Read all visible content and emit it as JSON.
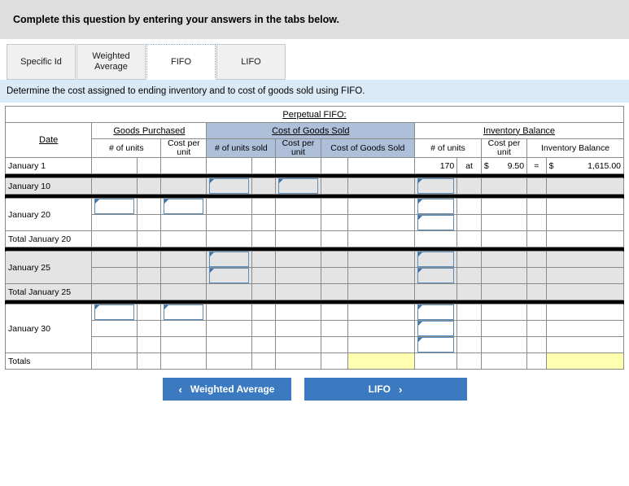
{
  "instruction": {
    "text": "Complete this question by entering your answers in the tabs below."
  },
  "tabs": [
    {
      "label": "Specific Id",
      "active": false
    },
    {
      "label": "Weighted Average",
      "active": false
    },
    {
      "label": "FIFO",
      "active": true
    },
    {
      "label": "LIFO",
      "active": false
    }
  ],
  "sub_instruction": {
    "text": "Determine the cost assigned to ending inventory and to cost of goods sold using FIFO."
  },
  "table": {
    "title": "Perpetual FIFO:",
    "groups": {
      "date": "Date",
      "goods_purchased": "Goods Purchased",
      "cost_of_goods_sold": "Cost of Goods Sold",
      "inventory_balance": "Inventory Balance"
    },
    "columns": {
      "gp_units": "# of units",
      "gp_cost_per_unit": "Cost per unit",
      "cogs_units_sold": "# of units sold",
      "cogs_cost_per_unit": "Cost per unit",
      "cogs_total": "Cost of Goods Sold",
      "inv_units": "# of units",
      "inv_cost_per_unit": "Cost per unit",
      "inv_balance": "Inventory Balance"
    },
    "rows": {
      "january_1": {
        "date": "January 1",
        "inv_units": "170",
        "at": "at",
        "inv_cost_dollar": "$",
        "inv_cost_per_unit": "9.50",
        "equals": "=",
        "inv_balance_dollar": "$",
        "inv_balance": "1,615.00"
      },
      "january_10": {
        "date": "January 10"
      },
      "january_20": {
        "date": "January 20"
      },
      "total_january_20": {
        "date": "Total January 20"
      },
      "january_25": {
        "date": "January 25"
      },
      "total_january_25": {
        "date": "Total January 25"
      },
      "january_30": {
        "date": "January 30"
      },
      "totals": {
        "date": "Totals"
      }
    }
  },
  "footer": {
    "prev_label": "Weighted Average",
    "prev_chevron": "‹",
    "next_label": "LIFO",
    "next_chevron": "›"
  },
  "colors": {
    "header_blue": "#81abdc",
    "header_blue_alt": "#aebfda",
    "instruction_gray": "#dedede",
    "sub_instruction_blue": "#daeaf7",
    "band_gray": "#e4e4e4",
    "yellow_cell": "#ffffaf",
    "button_blue": "#3b7ac0",
    "input_border": "#5b8db8"
  }
}
